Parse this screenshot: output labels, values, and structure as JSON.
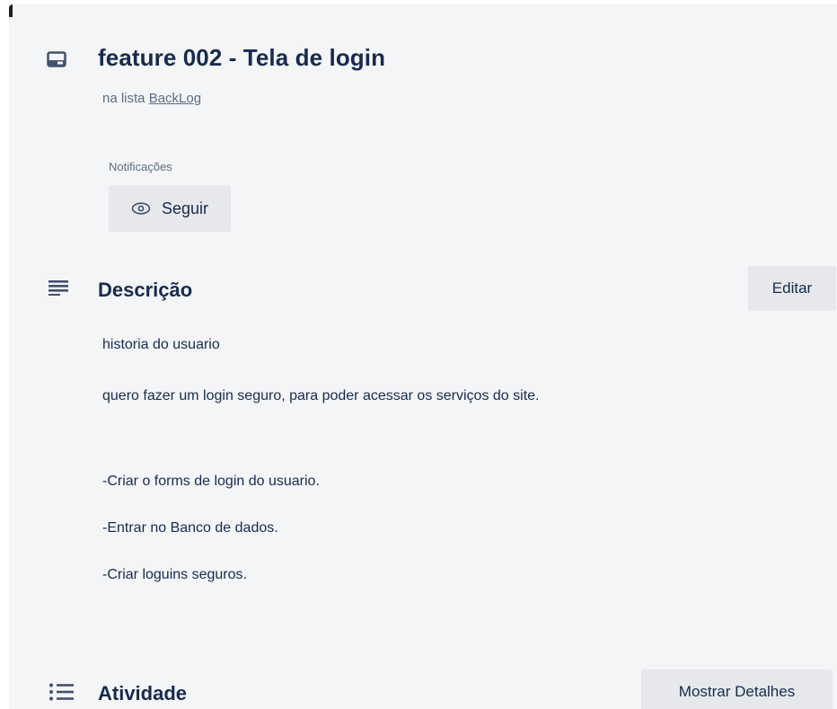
{
  "card": {
    "title": "feature 002 - Tela de login",
    "list_prefix": "na lista",
    "list_name": "BackLog",
    "notifications_label": "Notificações",
    "follow_label": "Seguir"
  },
  "description": {
    "heading": "Descrição",
    "edit_label": "Editar",
    "lines": [
      "historia do usuario",
      "quero fazer um login seguro, para poder acessar os serviços do site.",
      "-Criar o forms de login do usuario.",
      "-Entrar no Banco de dados.",
      "-Criar loguins seguros."
    ]
  },
  "activity": {
    "heading": "Atividade",
    "details_label": "Mostrar Detalhes"
  },
  "icons": {
    "card": "card-icon",
    "follow": "eye-icon",
    "description": "description-lines-icon",
    "activity": "activity-list-icon"
  }
}
